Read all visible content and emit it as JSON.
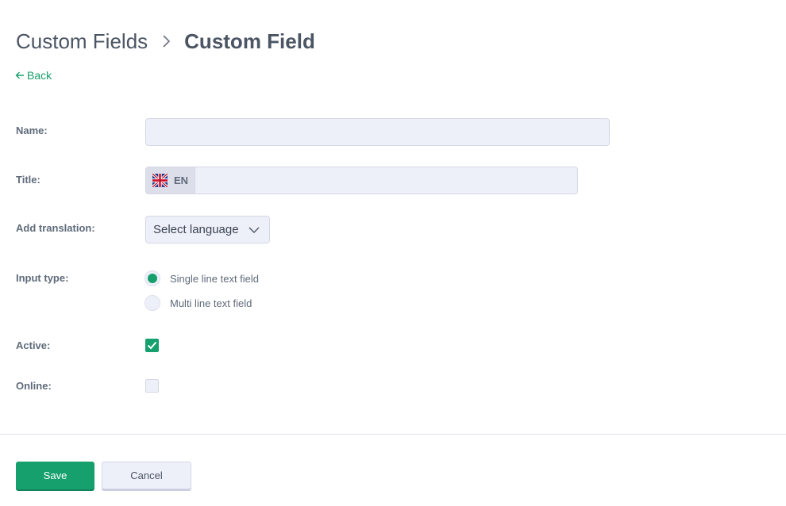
{
  "breadcrumb": {
    "parent": "Custom Fields",
    "current": "Custom Field"
  },
  "back_link": "Back",
  "form": {
    "name": {
      "label": "Name:",
      "value": ""
    },
    "title": {
      "label": "Title:",
      "lang_code": "EN",
      "flag_icon": "uk-flag-icon",
      "value": ""
    },
    "add_translation": {
      "label": "Add translation:",
      "selected": "Select language"
    },
    "input_type": {
      "label": "Input type:",
      "options": [
        {
          "label": "Single line text field",
          "selected": true
        },
        {
          "label": "Multi line text field",
          "selected": false
        }
      ]
    },
    "active": {
      "label": "Active:",
      "checked": true
    },
    "online": {
      "label": "Online:",
      "checked": false
    }
  },
  "actions": {
    "save": "Save",
    "cancel": "Cancel"
  },
  "colors": {
    "accent": "#16a06e",
    "field_bg": "#eef0f9",
    "text": "#4b5563"
  }
}
